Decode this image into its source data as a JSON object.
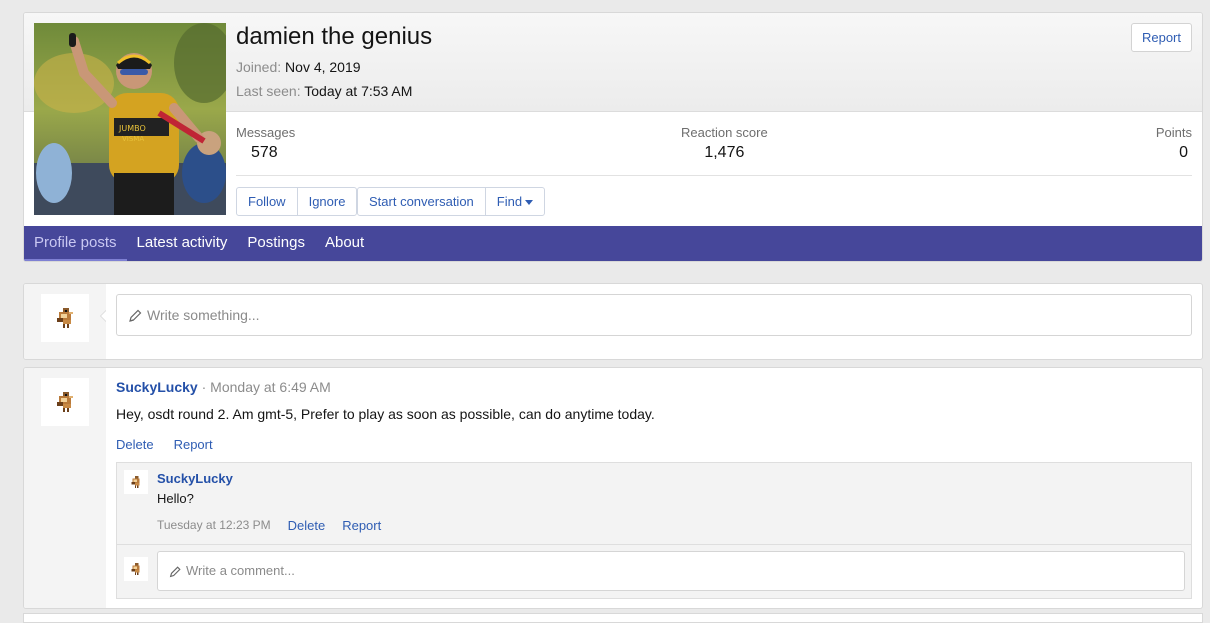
{
  "profile": {
    "username": "damien the genius",
    "joined_label": "Joined:",
    "joined_value": "Nov 4, 2019",
    "last_seen_label": "Last seen:",
    "last_seen_value": "Today at 7:53 AM",
    "report_label": "Report",
    "stats": [
      {
        "label": "Messages",
        "value": "578"
      },
      {
        "label": "Reaction score",
        "value": "1,476"
      },
      {
        "label": "Points",
        "value": "0"
      }
    ],
    "buttons": {
      "follow": "Follow",
      "ignore": "Ignore",
      "start_conversation": "Start conversation",
      "find": "Find"
    }
  },
  "tabs": [
    {
      "label": "Profile posts",
      "active": true
    },
    {
      "label": "Latest activity",
      "active": false
    },
    {
      "label": "Postings",
      "active": false
    },
    {
      "label": "About",
      "active": false
    }
  ],
  "composer": {
    "placeholder": "Write something..."
  },
  "post": {
    "author": "SuckyLucky",
    "separator": "·",
    "time": "Monday at 6:49 AM",
    "body": "Hey, osdt round 2. Am gmt-5, Prefer to play as soon as possible, can do anytime today.",
    "actions": {
      "delete": "Delete",
      "report": "Report"
    },
    "comment": {
      "author": "SuckyLucky",
      "text": "Hello?",
      "time": "Tuesday at 12:23 PM",
      "delete": "Delete",
      "report": "Report"
    },
    "comment_placeholder": "Write a comment..."
  },
  "colors": {
    "nav": "#46479a",
    "link": "#2f5db3",
    "username": "#2450a8"
  },
  "icons": {
    "composer": "pencil-icon",
    "avatar": "bird-sprite-icon",
    "dropdown": "caret-down-icon"
  }
}
